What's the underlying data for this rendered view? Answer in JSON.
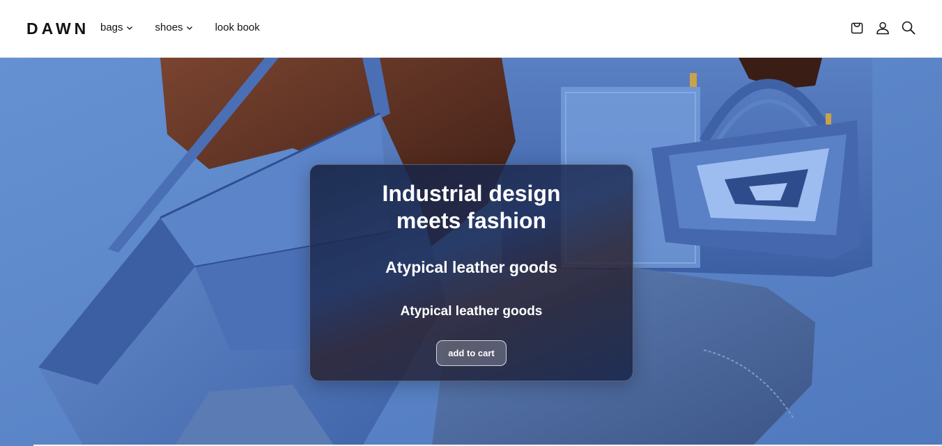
{
  "header": {
    "logo": "DAWN",
    "nav": [
      {
        "label": "bags",
        "has_dropdown": true
      },
      {
        "label": "shoes",
        "has_dropdown": true
      },
      {
        "label": "look book",
        "has_dropdown": false
      }
    ],
    "icons": [
      "cart-icon",
      "account-icon",
      "search-icon"
    ]
  },
  "hero": {
    "title_line1": "Industrial design",
    "title_line2": "meets fashion",
    "subtitle": "Atypical leather goods",
    "subtitle2": "Atypical leather goods",
    "button_label": "add to cart"
  },
  "colors": {
    "background_blue": "#5b86c9",
    "bag_blue": "#4a6fb5",
    "card_dark": "#1c2a50",
    "text_dark": "#121212"
  }
}
